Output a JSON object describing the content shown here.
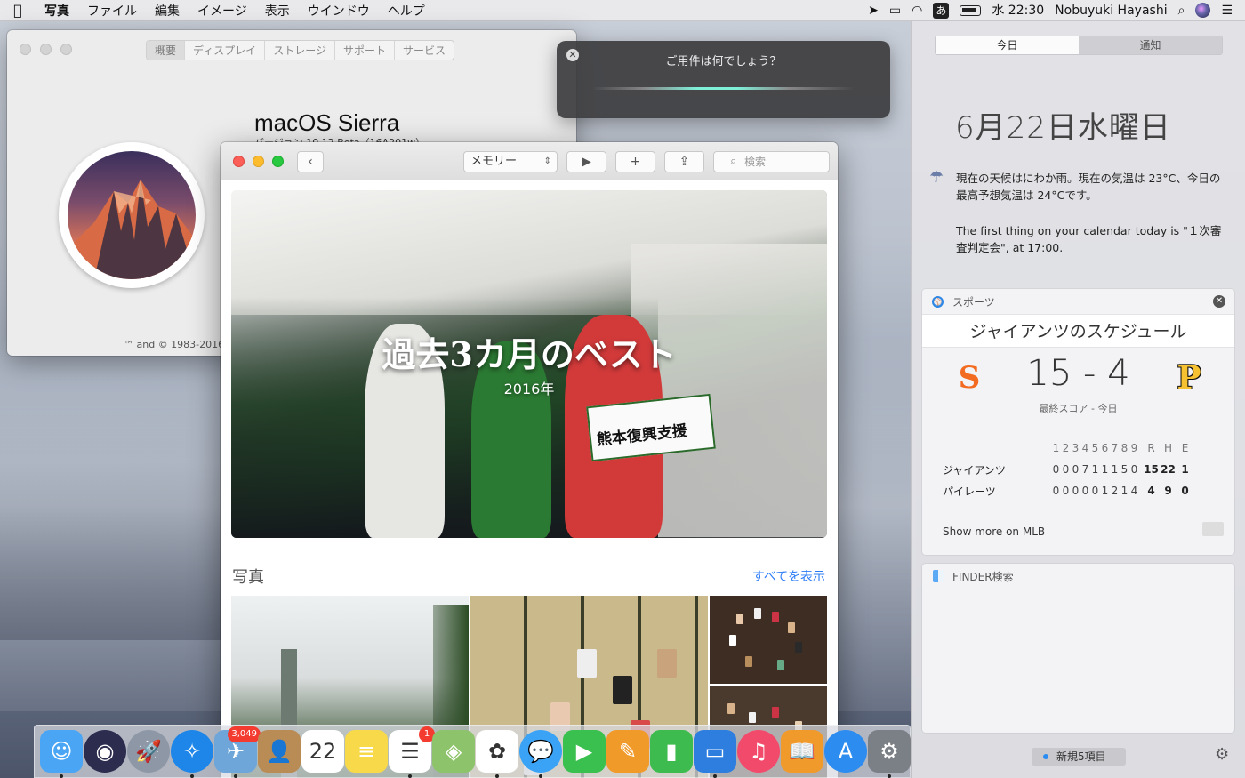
{
  "menubar": {
    "apple_glyph": "",
    "app_name": "写真",
    "menus": [
      "ファイル",
      "編集",
      "イメージ",
      "表示",
      "ウインドウ",
      "ヘルプ"
    ],
    "ime": "あ",
    "clock": "水 22:30",
    "user": "Nobuyuki Hayashi",
    "icons": [
      "location-icon",
      "airplay-icon",
      "wifi-icon",
      "ime-icon",
      "battery-icon",
      "search-icon",
      "siri-icon",
      "notification-center-icon"
    ]
  },
  "about_window": {
    "tabs": [
      "概要",
      "ディスプレイ",
      "ストレージ",
      "サポート",
      "サービス"
    ],
    "active_tab": "概要",
    "os_name": "macOS Sierra",
    "version": "バージョン 10.12 Beta（16A201w）",
    "copyright": "™ and © 1983-2016"
  },
  "siri": {
    "prompt": "ご用件は何でしょう？"
  },
  "photos_window": {
    "memory_select": "メモリー",
    "search_placeholder": "検索",
    "memory_title": "過去3カ月のベスト",
    "memory_year": "2016年",
    "section_title": "写真",
    "show_all": "すべてを表示",
    "sign_text": "熊本復興支援"
  },
  "notification_center": {
    "tabs": [
      "今日",
      "通知"
    ],
    "active_tab": "今日",
    "date": "6月22日水曜日",
    "weather": "現在の天候はにわか雨。現在の気温は 23°C、今日の最高予想気温は 24°Cです。",
    "calendar": "The first thing on your calendar today is \"１次審査判定会\", at 17:00.",
    "sports": {
      "header": "スポーツ",
      "title": "ジャイアンツのスケジュール",
      "score": "15 - 4",
      "status": "最終スコア - 今日",
      "innings_header": [
        "1",
        "2",
        "3",
        "4",
        "5",
        "6",
        "7",
        "8",
        "9"
      ],
      "totals_header": [
        "R",
        "H",
        "E"
      ],
      "rows": [
        {
          "team": "ジャイアンツ",
          "innings": [
            "0",
            "0",
            "0",
            "7",
            "1",
            "1",
            "1",
            "5",
            "0"
          ],
          "totals": [
            "15",
            "22",
            "1"
          ]
        },
        {
          "team": "パイレーツ",
          "innings": [
            "0",
            "0",
            "0",
            "0",
            "0",
            "1",
            "2",
            "1",
            "4"
          ],
          "totals": [
            "4",
            "9",
            "0"
          ]
        }
      ],
      "more_link": "Show more on MLB"
    },
    "finder": {
      "header": "FINDER検索"
    },
    "footer": "新規5項目"
  },
  "dock": {
    "items": [
      {
        "name": "finder-icon",
        "bg": "#4aa6f4",
        "glyph": "☺",
        "running": true
      },
      {
        "name": "siri-icon",
        "bg": "#2c2c4e",
        "glyph": "◉",
        "running": false,
        "round": true
      },
      {
        "name": "launchpad-icon",
        "bg": "#8e97a6",
        "glyph": "🚀",
        "running": false,
        "round": true
      },
      {
        "name": "safari-icon",
        "bg": "#1d86e8",
        "glyph": "✧",
        "running": true,
        "round": true
      },
      {
        "name": "mail-icon",
        "bg": "#6ea6d9",
        "glyph": "✈",
        "running": true,
        "badge": "3,049"
      },
      {
        "name": "contacts-icon",
        "bg": "#b98b55",
        "glyph": "👤",
        "running": false
      },
      {
        "name": "calendar-icon",
        "bg": "#ffffff",
        "glyph": "22",
        "running": false,
        "dark": true
      },
      {
        "name": "notes-icon",
        "bg": "#f7d94a",
        "glyph": "≡",
        "running": false
      },
      {
        "name": "reminders-icon",
        "bg": "#ffffff",
        "glyph": "☰",
        "running": true,
        "dark": true,
        "badge": "1"
      },
      {
        "name": "maps-icon",
        "bg": "#8dc36a",
        "glyph": "◈",
        "running": false
      },
      {
        "name": "photos-icon",
        "bg": "#ffffff",
        "glyph": "✿",
        "running": true,
        "dark": true
      },
      {
        "name": "messages-icon",
        "bg": "#3aa3f5",
        "glyph": "💬",
        "running": true,
        "round": true
      },
      {
        "name": "facetime-icon",
        "bg": "#39c04f",
        "glyph": "▶",
        "running": false
      },
      {
        "name": "pages-icon",
        "bg": "#f09a2a",
        "glyph": "✎",
        "running": false
      },
      {
        "name": "numbers-icon",
        "bg": "#3dbb4e",
        "glyph": "▮",
        "running": false
      },
      {
        "name": "keynote-icon",
        "bg": "#2e7ee0",
        "glyph": "▭",
        "running": true
      },
      {
        "name": "itunes-icon",
        "bg": "#f24a6b",
        "glyph": "♫",
        "running": false,
        "round": true
      },
      {
        "name": "ibooks-icon",
        "bg": "#f19a2c",
        "glyph": "📖",
        "running": false
      },
      {
        "name": "app-store-icon",
        "bg": "#2d8cf0",
        "glyph": "A",
        "running": false,
        "round": true
      },
      {
        "name": "system-preferences-icon",
        "bg": "#7b7f86",
        "glyph": "⚙",
        "running": true
      }
    ]
  }
}
